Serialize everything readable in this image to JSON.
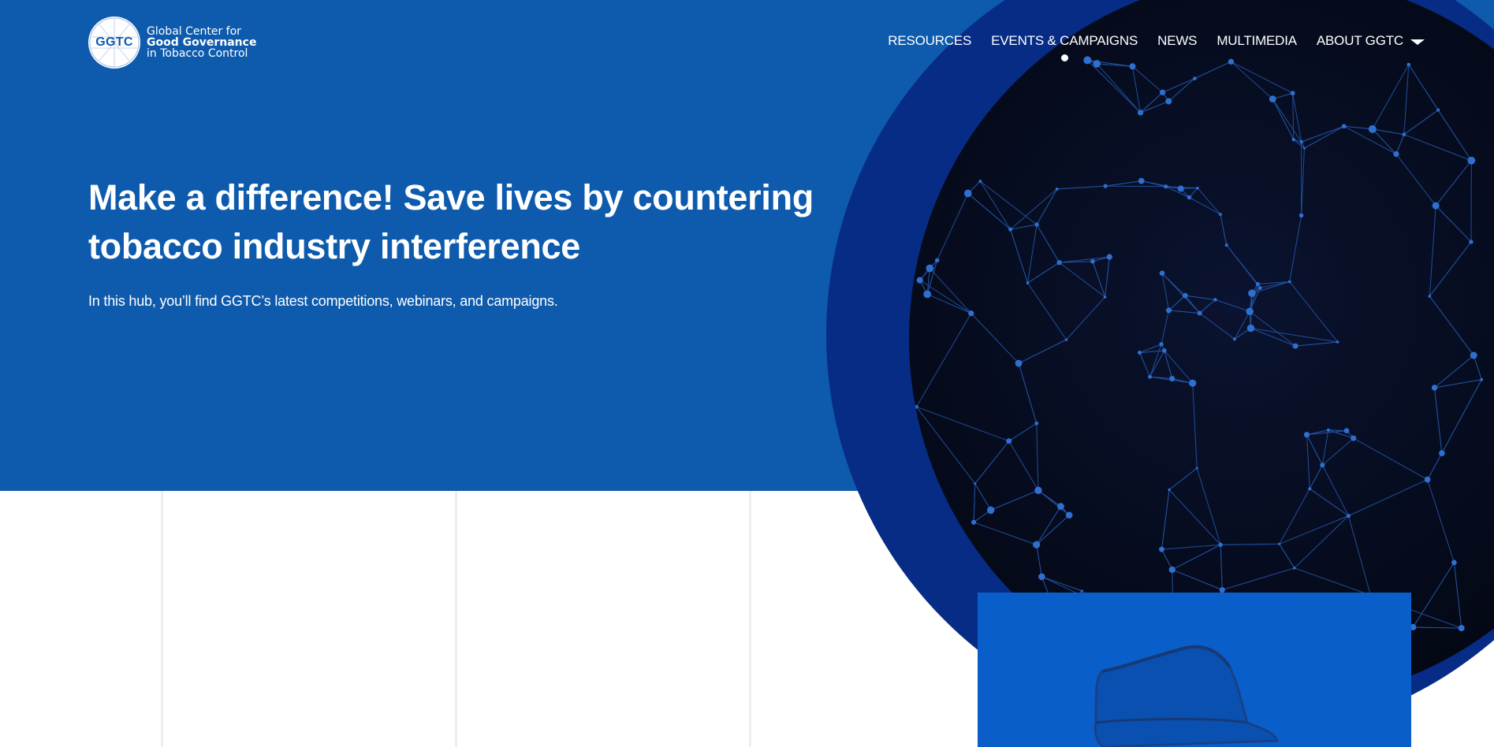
{
  "logo": {
    "mark_text": "GGTC",
    "line1": "Global Center for",
    "line2": "Good Governance",
    "line3": "in Tobacco Control"
  },
  "nav": {
    "items": [
      {
        "label": "RESOURCES",
        "active": false
      },
      {
        "label": "EVENTS & CAMPAIGNS",
        "active": true
      },
      {
        "label": "NEWS",
        "active": false
      },
      {
        "label": "MULTIMEDIA",
        "active": false
      },
      {
        "label": "ABOUT GGTC",
        "active": false,
        "has_dropdown": true
      }
    ]
  },
  "hero": {
    "title": "Make a difference! Save lives by countering tobacco industry interference",
    "subtitle": "In this hub, you’ll find GGTC’s latest competitions, webinars, and campaigns."
  },
  "colors": {
    "hero_blue": "#0e5bad",
    "ring_blue": "#062a84",
    "globe_dark": "#050a18",
    "network_blue": "#2a63c0",
    "card_blue": "#0a5ec9"
  },
  "icons": {
    "logo": "globe-logo-icon",
    "dropdown": "chevron-down-icon",
    "card_image": "hat-icon"
  }
}
